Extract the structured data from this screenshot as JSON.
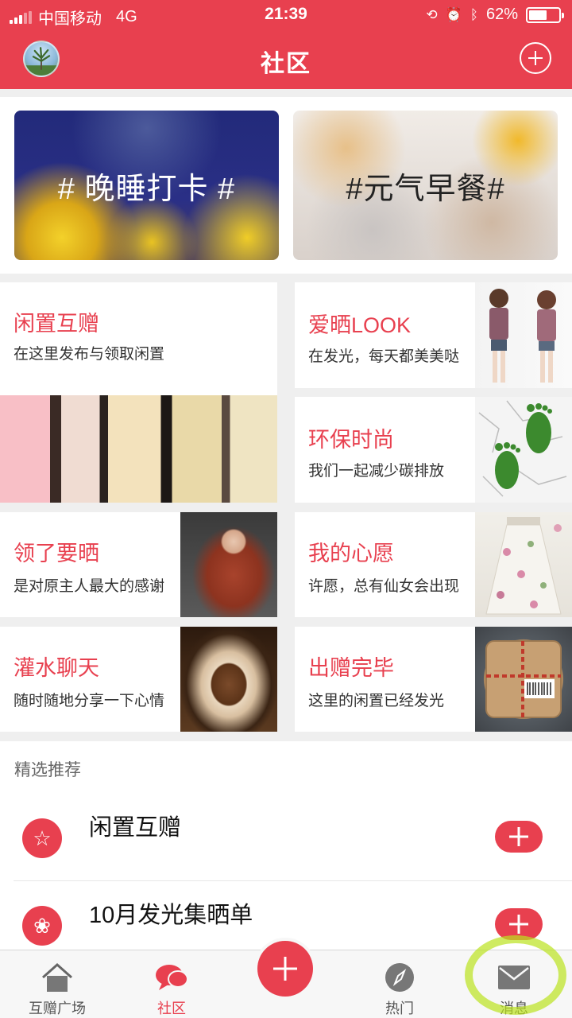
{
  "status_bar": {
    "carrier": "中国移动",
    "network": "4G",
    "time": "21:39",
    "battery": "62%",
    "battery_level": 0.62,
    "icons": [
      "rotation-lock-icon",
      "alarm-icon",
      "bluetooth-icon"
    ]
  },
  "header": {
    "title": "社区",
    "accent": "#e8404f"
  },
  "banners": [
    {
      "text": "# 晚睡打卡 #"
    },
    {
      "text": "#元气早餐#"
    }
  ],
  "grid": {
    "left": [
      {
        "title": "闲置互赠",
        "subtitle": "在这里发布与领取闲置"
      },
      {
        "title": "领了要晒",
        "subtitle": "是对原主人最大的感谢"
      },
      {
        "title": "灌水聊天",
        "subtitle": "随时随地分享一下心情"
      }
    ],
    "right": [
      {
        "title": "爱晒LOOK",
        "subtitle": "在发光，每天都美美哒"
      },
      {
        "title": "环保时尚",
        "subtitle": "我们一起减少碳排放"
      },
      {
        "title": "我的心愿",
        "subtitle": "许愿，总有仙女会出现"
      },
      {
        "title": "出赠完毕",
        "subtitle": "这里的闲置已经发光"
      }
    ]
  },
  "featured": {
    "label": "精选推荐",
    "items": [
      {
        "name": "闲置互赠",
        "icon": "star-icon"
      },
      {
        "name": "10月发光集晒单",
        "icon": "flower-icon"
      }
    ]
  },
  "tabbar": {
    "items": [
      {
        "label": "互赠广场",
        "icon": "home-icon"
      },
      {
        "label": "社区",
        "icon": "chat-icon"
      },
      {
        "label": "",
        "icon": "plus-icon"
      },
      {
        "label": "热门",
        "icon": "compass-icon"
      },
      {
        "label": "消息",
        "icon": "mail-icon"
      }
    ],
    "active": "社区"
  }
}
